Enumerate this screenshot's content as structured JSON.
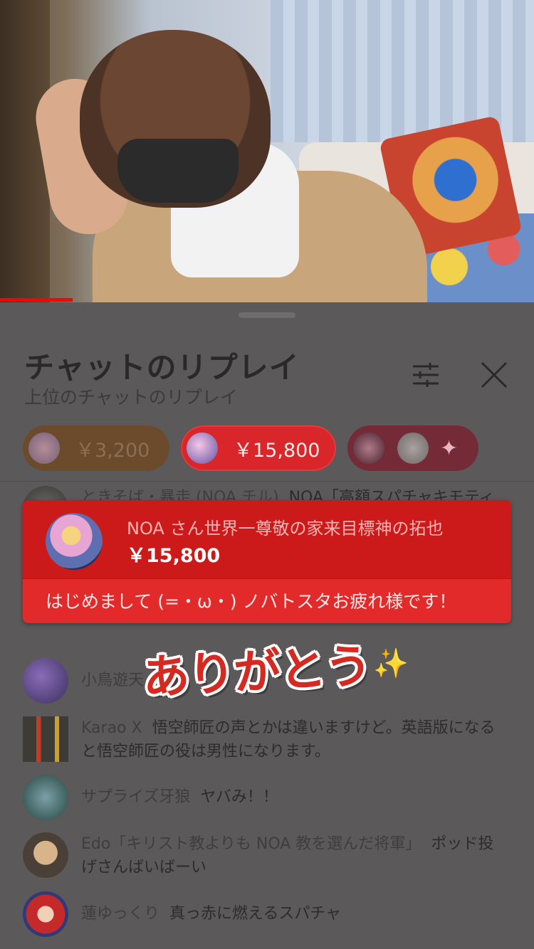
{
  "header": {
    "title": "チャットのリプレイ",
    "subtitle": "上位のチャットのリプレイ"
  },
  "chips": [
    {
      "amount": "￥3,200"
    },
    {
      "amount": "￥15,800"
    },
    {
      "icon": "sparkles-icon",
      "glyph": "✦"
    }
  ],
  "partial_message": {
    "author": "ときそば・暴走 (NOA チル)",
    "text": "NOA「高額スパチャキモティ"
  },
  "superchat": {
    "author": "NOA さん世界一尊敬の家来目標神の拓也",
    "amount": "￥15,800",
    "message": "はじめまして (=・ω・) ノバトスタお疲れ様です！",
    "color": "#cc1919"
  },
  "overlay_sticker": {
    "text": "ありがとう",
    "sparkle": "✨"
  },
  "messages": [
    {
      "author": "小鳥遊天",
      "text": ""
    },
    {
      "author": "Karao X",
      "text": "悟空師匠の声とかは違いますけど。英語版になると悟空師匠の役は男性になります。"
    },
    {
      "author": "サプライズ牙狼",
      "text": "ヤバみ！！"
    },
    {
      "author": "Edo「キリスト教よりも NOA 教を選んだ将軍」",
      "text": "ポッド投げさんばいばーい"
    },
    {
      "author": "蓮ゆっくり",
      "text": "真っ赤に燃えるスパチャ"
    }
  ],
  "colors": {
    "accent_red": "#d8262a",
    "sheet_bg": "#5b5959",
    "progress": "#ff0000"
  }
}
